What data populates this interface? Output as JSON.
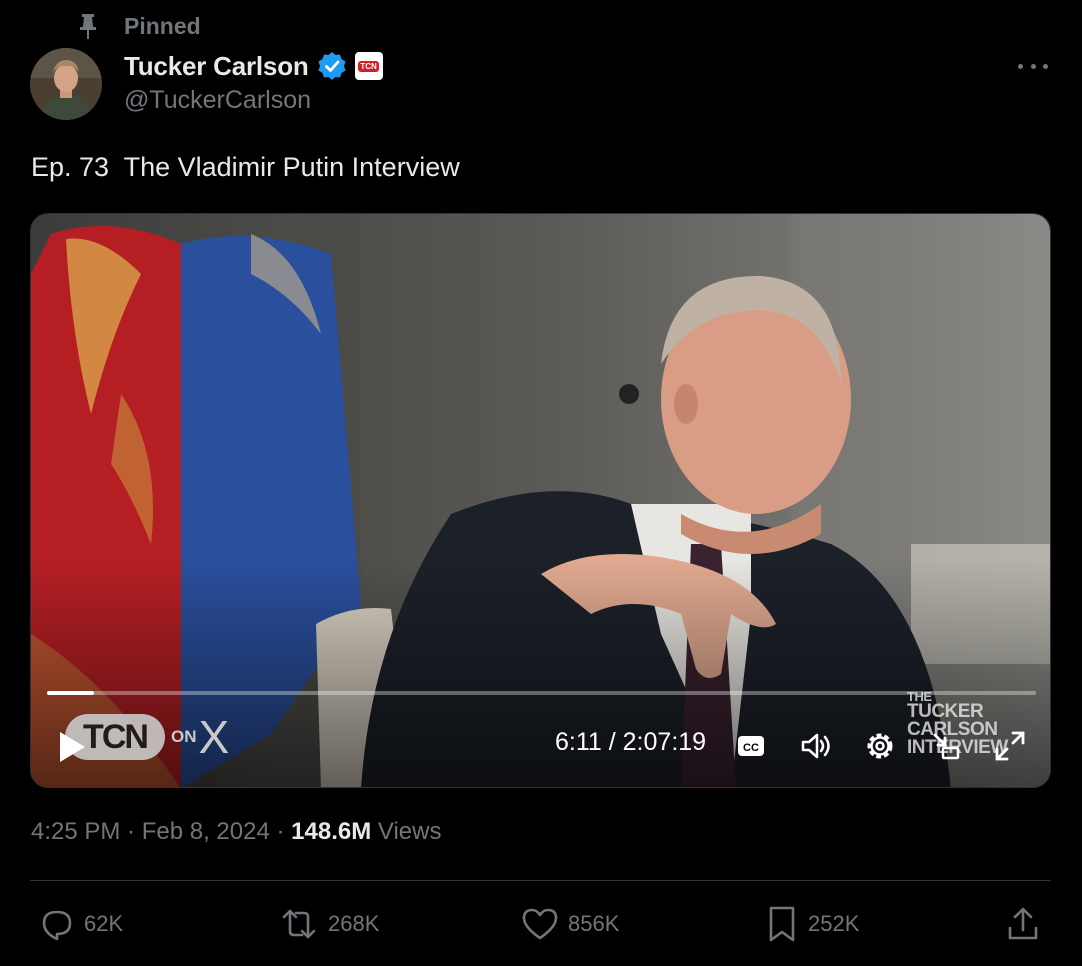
{
  "pinned": {
    "label": "Pinned",
    "icon": "pin-icon"
  },
  "author": {
    "name": "Tucker Carlson",
    "handle": "@TuckerCarlson",
    "verified_icon": "verified-badge-icon",
    "affiliate_badge_text": "TCN",
    "avatar": "avatar"
  },
  "tweet": {
    "text": "Ep. 73  The Vladimir Putin Interview"
  },
  "video": {
    "time_current": "6:11",
    "time_total": "2:07:19",
    "progress_fraction": 0.048,
    "overlay_logo": "TCN",
    "overlay_on": "ON",
    "overlay_x": "X",
    "watermark": [
      "THE",
      "TUCKER",
      "CARLSON",
      "INTERVIEW"
    ],
    "controls": [
      "play-icon",
      "cc-icon",
      "volume-icon",
      "settings-icon",
      "pip-icon",
      "fullscreen-icon"
    ]
  },
  "meta": {
    "time": "4:25 PM",
    "date": "Feb 8, 2024",
    "views_count": "148.6M",
    "views_label": "Views"
  },
  "actions": {
    "replies": "62K",
    "reposts": "268K",
    "likes": "856K",
    "bookmarks": "252K"
  },
  "colors": {
    "background": "#000000",
    "text": "#e7e9ea",
    "muted": "#71767b",
    "verified": "#1d9bf0",
    "divider": "#2f3336"
  }
}
